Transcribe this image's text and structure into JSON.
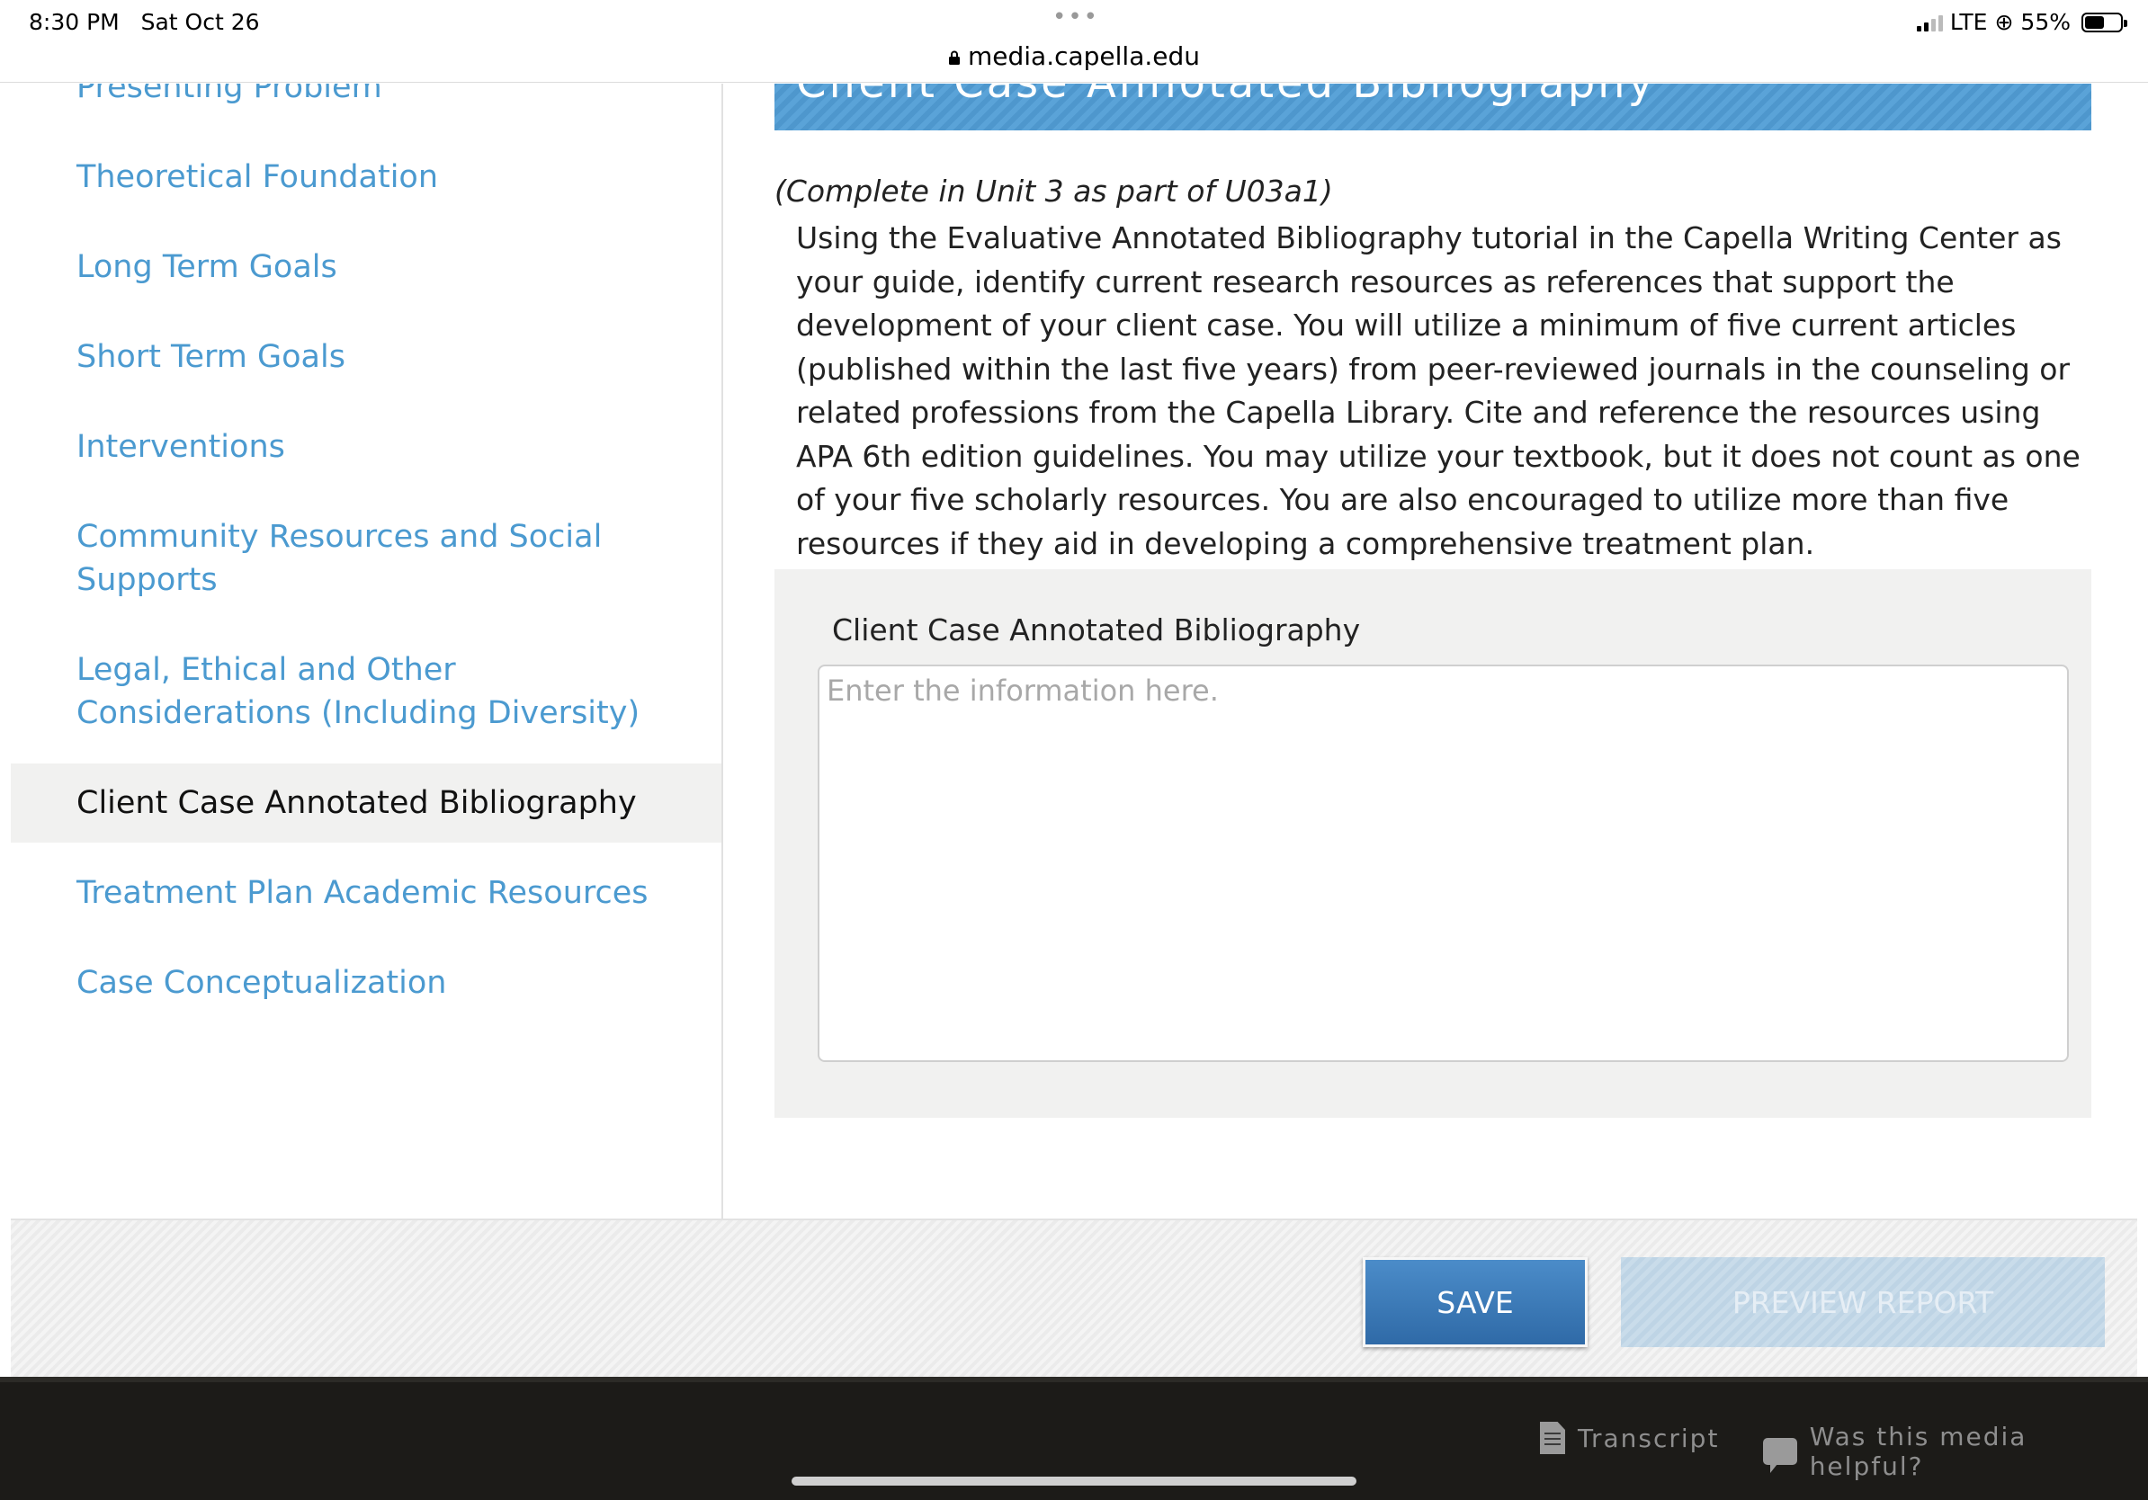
{
  "status_bar": {
    "time": "8:30 PM",
    "date": "Sat Oct 26",
    "dots": "•••",
    "url": "media.capella.edu",
    "network": "LTE",
    "battery": "55%",
    "battery_level": 0.55
  },
  "sidebar": {
    "items": [
      {
        "label": "Presenting Problem"
      },
      {
        "label": "Theoretical Foundation"
      },
      {
        "label": "Long Term Goals"
      },
      {
        "label": "Short Term Goals"
      },
      {
        "label": "Interventions"
      },
      {
        "label": "Community Resources and Social Supports"
      },
      {
        "label": "Legal, Ethical and Other Considerations (Including Diversity)"
      },
      {
        "label": "Client Case Annotated Bibliography",
        "active": true
      },
      {
        "label": "Treatment Plan Academic Resources"
      },
      {
        "label": "Case Conceptualization"
      }
    ]
  },
  "main": {
    "banner_title": "Client Case Annotated Bibliography",
    "unit_note": "(Complete in Unit 3 as part of U03a1)",
    "instructions": "Using the Evaluative Annotated Bibliography tutorial in the Capella Writing Center as your guide, identify current research resources as references that support the development of your client case. You will utilize a minimum of five current articles (published within the last five years) from peer-reviewed journals in the counseling or related professions from the Capella Library. Cite and reference the resources using APA 6th edition guidelines. You may utilize your textbook, but it does not count as one of your five scholarly resources. You are also encouraged to utilize more than five resources if they aid in developing a comprehensive treatment plan.",
    "field_label": "Client Case Annotated Bibliography",
    "field_placeholder": "Enter the information here.",
    "field_value": ""
  },
  "actions": {
    "save_label": "SAVE",
    "preview_label": "PREVIEW REPORT"
  },
  "footer": {
    "transcript_label": "Transcript",
    "feedback_label": "Was this media helpful?"
  }
}
